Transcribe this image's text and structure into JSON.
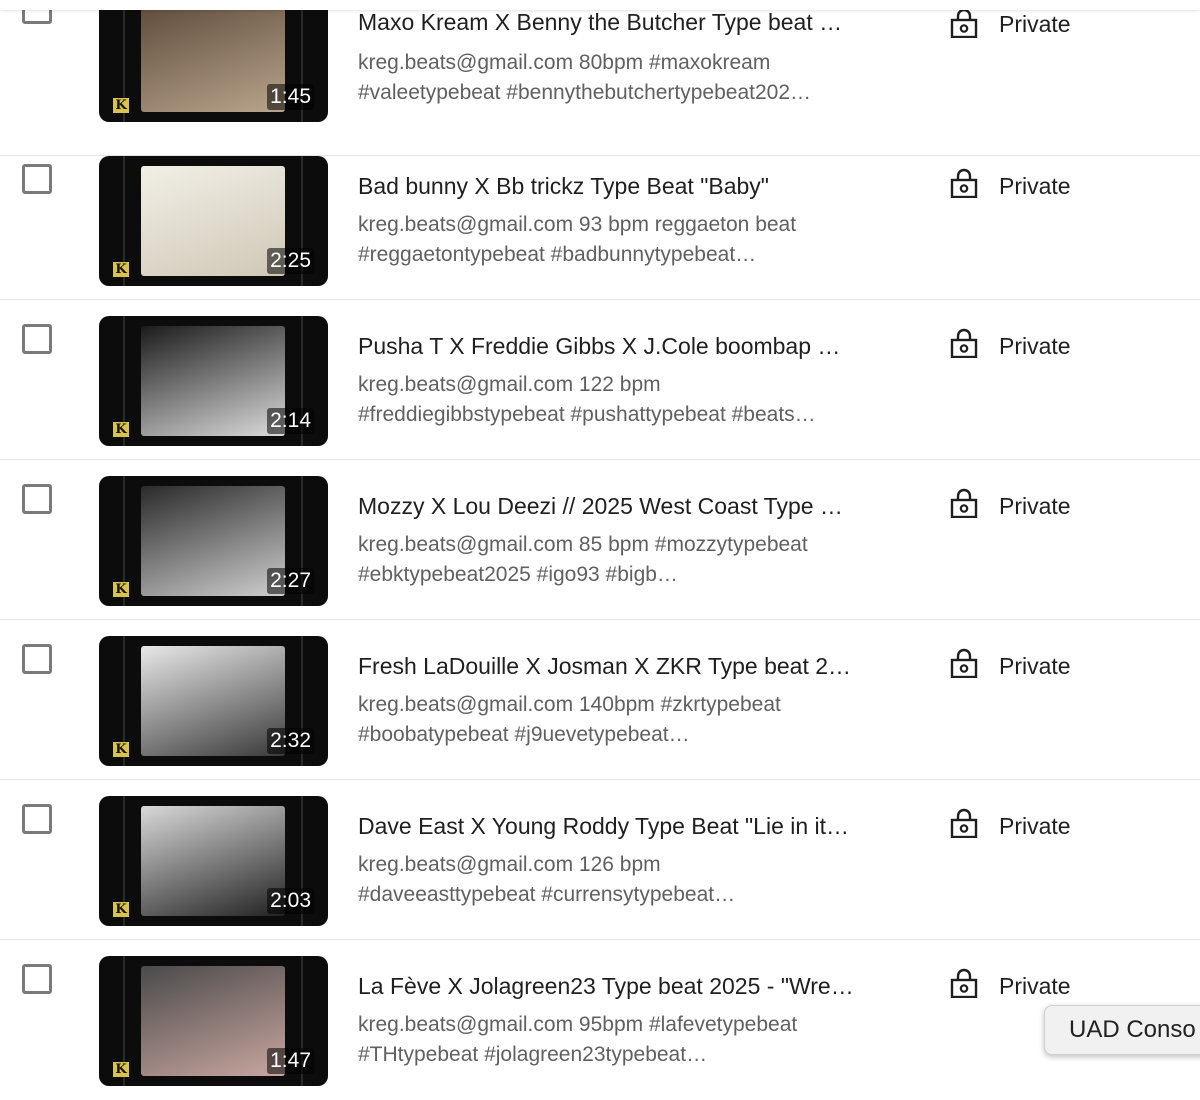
{
  "videos": [
    {
      "title": "Maxo Kream X Benny the Butcher Type beat …",
      "desc_line1": "kreg.beats@gmail.com 80bpm #maxokream",
      "desc_line2": "#valeetypebeat #bennythebutchertypebeat202…",
      "duration": "1:45",
      "visibility": "Private",
      "thumb_logo": "K",
      "thumb_colors": [
        "#5d4a3a",
        "#b9a58c"
      ]
    },
    {
      "title": "Bad bunny X Bb trickz Type Beat \"Baby\"",
      "desc_line1": "kreg.beats@gmail.com 93 bpm reggaeton beat",
      "desc_line2": "#reggaetontypebeat #badbunnytypebeat…",
      "duration": "2:25",
      "visibility": "Private",
      "thumb_logo": "K",
      "thumb_colors": [
        "#f1efe7",
        "#cfc8b6"
      ]
    },
    {
      "title": "Pusha T X Freddie Gibbs X J.Cole boombap …",
      "desc_line1": "kreg.beats@gmail.com 122 bpm",
      "desc_line2": "#freddiegibbstypebeat #pushattypebeat #beats…",
      "duration": "2:14",
      "visibility": "Private",
      "thumb_logo": "K",
      "thumb_colors": [
        "#1b1b1b",
        "#dcdcdc"
      ]
    },
    {
      "title": "Mozzy X Lou Deezi // 2025 West Coast Type …",
      "desc_line1": "kreg.beats@gmail.com 85 bpm #mozzytypebeat",
      "desc_line2": "#ebktypebeat2025 #igo93 #bigb…",
      "duration": "2:27",
      "visibility": "Private",
      "thumb_logo": "K",
      "thumb_colors": [
        "#2a2a2a",
        "#cfcfcf"
      ]
    },
    {
      "title": "Fresh LaDouille X Josman X ZKR Type beat 2…",
      "desc_line1": "kreg.beats@gmail.com 140bpm #zkrtypebeat",
      "desc_line2": "#boobatypebeat #j9uevetypebeat…",
      "duration": "2:32",
      "visibility": "Private",
      "thumb_logo": "K",
      "thumb_colors": [
        "#e8e8e8",
        "#3a3a3a"
      ]
    },
    {
      "title": "Dave East X Young Roddy Type Beat \"Lie in it…",
      "desc_line1": "kreg.beats@gmail.com 126 bpm",
      "desc_line2": "#daveeasttypebeat #currensytypebeat…",
      "duration": "2:03",
      "visibility": "Private",
      "thumb_logo": "K",
      "thumb_colors": [
        "#d9d9d9",
        "#222222"
      ]
    },
    {
      "title": "La Fève X Jolagreen23 Type beat 2025 - \"Wre…",
      "desc_line1": "kreg.beats@gmail.com 95bpm #lafevetypebeat",
      "desc_line2": "#THtypebeat #jolagreen23typebeat…",
      "duration": "1:47",
      "visibility": "Private",
      "thumb_logo": "K",
      "thumb_colors": [
        "#4a4a4a",
        "#c9a6a0"
      ]
    }
  ],
  "tooltip": {
    "text": "UAD Conso"
  }
}
